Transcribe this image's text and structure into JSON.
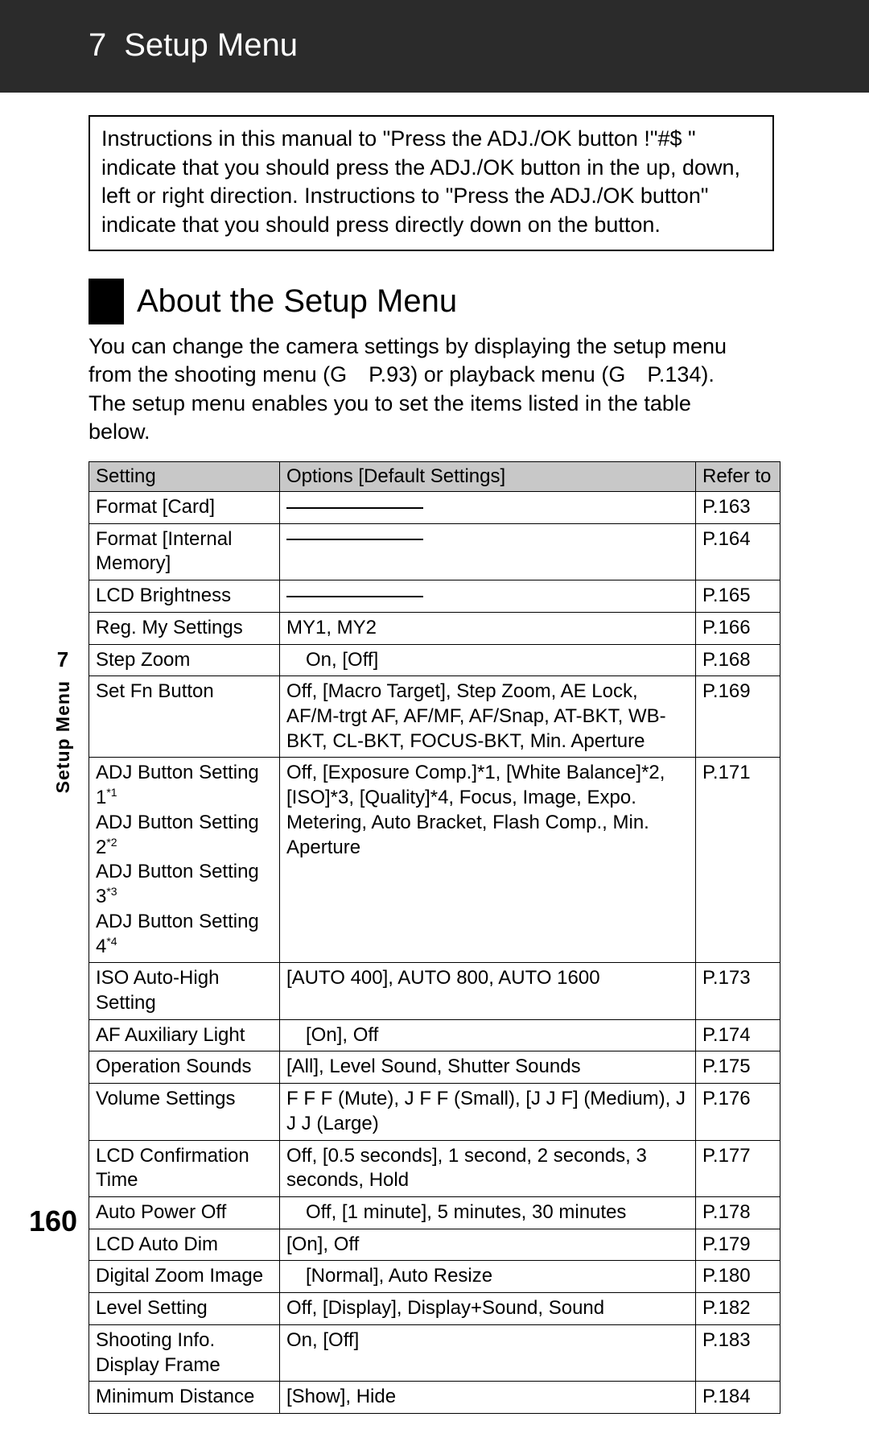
{
  "chapter_number": "7",
  "chapter_title": "Setup Menu",
  "page_number": "160",
  "side_label_chapter": "7",
  "side_label_text": "Setup Menu",
  "note_text": "Instructions in this manual to \"Press the ADJ./OK button !\"#$      \" indicate that you should press the ADJ./OK button in the up, down, left or right direction. Instructions to \"Press the ADJ./OK button\" indicate that you should press directly down on the button.",
  "section_title": "About the Setup Menu",
  "intro_text": "You can change the camera settings by displaying the setup menu from the shooting menu (G P.93) or playback menu (G P.134). The setup menu enables you to set the items listed in the table below.",
  "table": {
    "headers": {
      "setting": "Setting",
      "options": "Options [Default Settings]",
      "refer": "Refer to"
    },
    "rows": [
      {
        "setting": "Format [Card]",
        "options_dash": true,
        "refer": "P.163"
      },
      {
        "setting": "Format [Internal Memory]",
        "options_dash": true,
        "refer": "P.164"
      },
      {
        "setting": "LCD Brightness",
        "options_dash": true,
        "refer": "P.165"
      },
      {
        "setting": "Reg. My Settings",
        "options": "MY1, MY2",
        "refer": "P.166"
      },
      {
        "setting": "Step Zoom",
        "options": " On, [Off]",
        "refer": "P.168"
      },
      {
        "setting": "Set Fn Button",
        "options": "Off, [Macro Target], Step Zoom, AE Lock, AF/M-trgt AF, AF/MF, AF/Snap, AT-BKT, WB-BKT, CL-BKT, FOCUS-BKT, Min. Aperture",
        "refer": "P.169"
      },
      {
        "setting": "ADJ Button Setting 1\nADJ Button Setting 2\nADJ Button Setting 3\nADJ Button Setting 4",
        "setting_sups": [
          "*1",
          "*2",
          "*3",
          "*4"
        ],
        "options": "Off, [Exposure Comp.]*1, [White Balance]*2, [ISO]*3, [Quality]*4, Focus, Image, Expo. Metering, Auto Bracket, Flash Comp., Min. Aperture",
        "refer": "P.171"
      },
      {
        "setting": "ISO Auto-High Setting",
        "options": "[AUTO 400], AUTO 800, AUTO 1600",
        "refer": "P.173"
      },
      {
        "setting": "AF Auxiliary Light",
        "options": " [On], Off",
        "refer": "P.174"
      },
      {
        "setting": "Operation Sounds",
        "options": "[All], Level Sound, Shutter Sounds",
        "refer": "P.175"
      },
      {
        "setting": "Volume Settings",
        "options": "F F F (Mute), J F F (Small), [J J F] (Medium), J J J (Large)",
        "refer": "P.176"
      },
      {
        "setting": "LCD Confirmation Time",
        "options": "Off, [0.5 seconds], 1 second, 2 seconds, 3 seconds, Hold",
        "refer": "P.177"
      },
      {
        "setting": "Auto Power Off",
        "options": " Off, [1 minute], 5 minutes, 30 minutes",
        "refer": "P.178"
      },
      {
        "setting": "LCD Auto Dim",
        "options": "[On], Off",
        "refer": "P.179"
      },
      {
        "setting": "Digital Zoom Image",
        "options": " [Normal], Auto Resize",
        "refer": "P.180"
      },
      {
        "setting": "Level Setting",
        "options": "Off, [Display], Display+Sound, Sound",
        "refer": "P.182"
      },
      {
        "setting": "Shooting Info. Display Frame",
        "options": "On, [Off]",
        "refer": "P.183"
      },
      {
        "setting": "Minimum Distance",
        "options": "[Show], Hide",
        "refer": "P.184"
      }
    ]
  }
}
